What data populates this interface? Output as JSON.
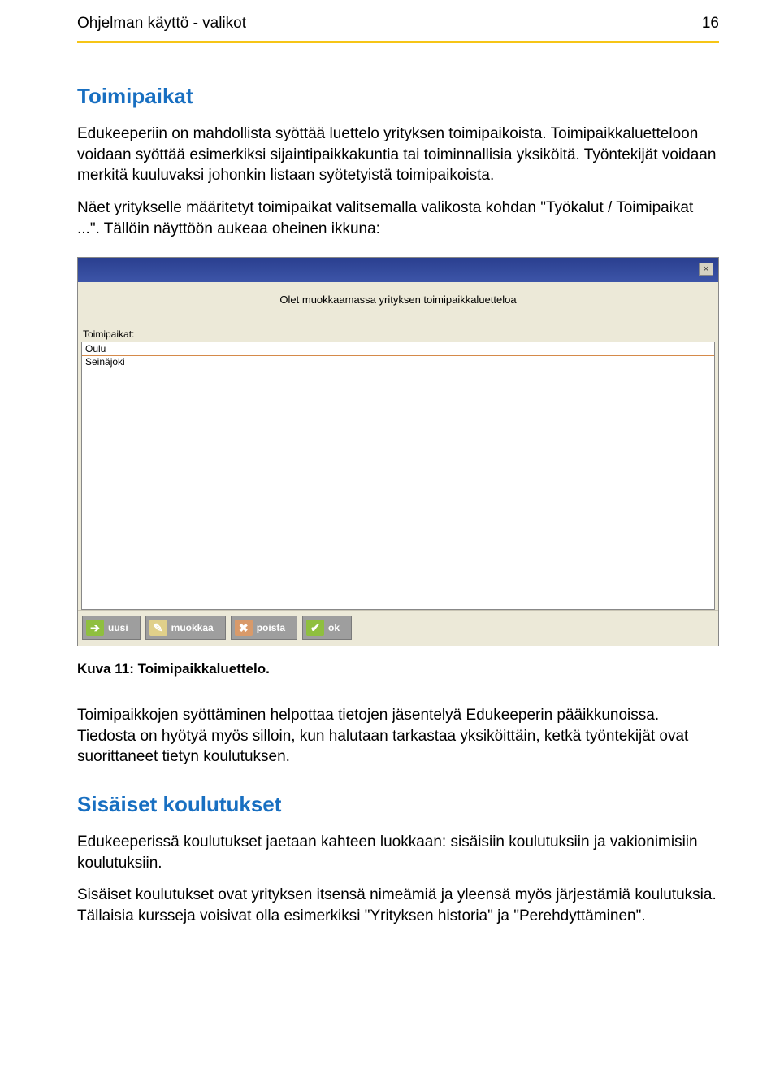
{
  "header": {
    "breadcrumb": "Ohjelman käyttö -  valikot",
    "page_number": "16"
  },
  "section1": {
    "title": "Toimipaikat",
    "p1": "Edukeeperiin on mahdollista syöttää luettelo yrityksen toimipaikoista. Toimipaikkaluetteloon voidaan syöttää esimerkiksi sijaintipaikkakuntia tai toiminnallisia yksiköitä. Työntekijät voidaan merkitä kuuluvaksi johonkin listaan syötetyistä toimipaikoista.",
    "p2": "Näet yritykselle määritetyt toimipaikat valitsemalla valikosta kohdan \"Työkalut / Toimipaikat ...\". Tällöin näyttöön aukeaa oheinen ikkuna:"
  },
  "dialog": {
    "subheader": "Olet muokkaamassa yrityksen toimipaikkaluetteloa",
    "list_label": "Toimipaikat:",
    "rows": [
      "Oulu",
      "Seinäjoki"
    ],
    "buttons": {
      "uusi": "uusi",
      "muokkaa": "muokkaa",
      "poista": "poista",
      "ok": "ok"
    }
  },
  "caption": "Kuva 11: Toimipaikkaluettelo.",
  "section1b": {
    "p3": "Toimipaikkojen syöttäminen helpottaa tietojen jäsentelyä Edukeeperin pääikkunoissa. Tiedosta on hyötyä myös silloin, kun halutaan tarkastaa yksiköittäin, ketkä työntekijät ovat suorittaneet tietyn koulutuksen."
  },
  "section2": {
    "title": "Sisäiset koulutukset",
    "p1": "Edukeeperissä koulutukset jaetaan kahteen luokkaan: sisäisiin koulutuksiin ja vakionimisiin koulutuksiin.",
    "p2": "Sisäiset koulutukset ovat yrityksen itsensä nimeämiä ja yleensä myös järjestämiä koulutuksia. Tällaisia kursseja voisivat olla esimerkiksi \"Yrityksen historia\" ja \"Perehdyttäminen\"."
  }
}
